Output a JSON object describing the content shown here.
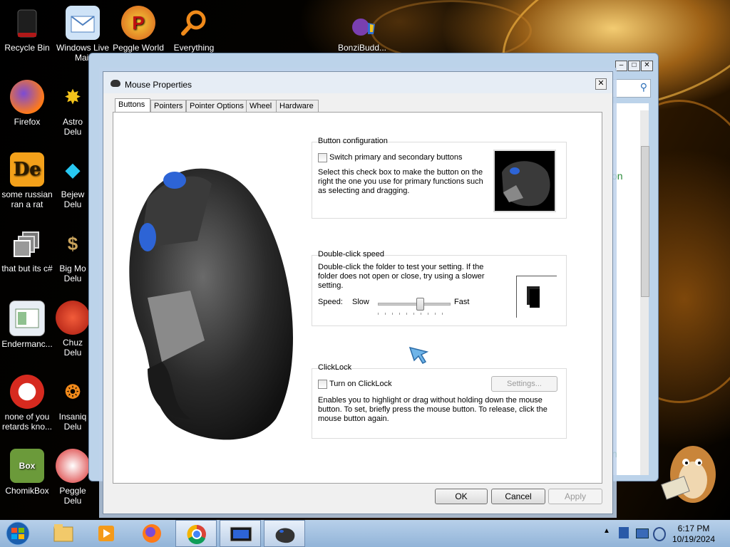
{
  "desktop": {
    "icons": [
      {
        "label": "Recycle Bin"
      },
      {
        "label": "Windows Live Mail"
      },
      {
        "label": "Peggle World"
      },
      {
        "label": "Everything"
      },
      {
        "label": "BonziBudd..."
      },
      {
        "label": "Firefox"
      },
      {
        "label": "Astro Delu"
      },
      {
        "label": "some russian ran a rat"
      },
      {
        "label": "Bejew Delu"
      },
      {
        "label": "that but its c#"
      },
      {
        "label": "Big Mo Delu"
      },
      {
        "label": "Endermanc..."
      },
      {
        "label": "Chuz Delu"
      },
      {
        "label": "none of you retards kno..."
      },
      {
        "label": "Insaniq Delu"
      },
      {
        "label": "ChomikBox"
      },
      {
        "label": "Peggle Delu"
      }
    ]
  },
  "background_window": {
    "partial_text_1": "on",
    "partial_text_2": "n"
  },
  "dialog": {
    "title": "Mouse Properties",
    "close": "✕",
    "tabs": [
      "Buttons",
      "Pointers",
      "Pointer Options",
      "Wheel",
      "Hardware"
    ],
    "active_tab": "Buttons",
    "button_config": {
      "title": "Button configuration",
      "checkbox_label": "Switch primary and secondary buttons",
      "checked": false,
      "description": "Select this check box to make the button on the right the one you use for primary functions such as selecting and dragging."
    },
    "double_click": {
      "title": "Double-click speed",
      "description": "Double-click the folder to test your setting. If the folder does not open or close, try using a slower setting.",
      "speed_label": "Speed:",
      "slow_label": "Slow",
      "fast_label": "Fast",
      "speed_value": 0.58
    },
    "clicklock": {
      "title": "ClickLock",
      "checkbox_label": "Turn on ClickLock",
      "checked": false,
      "settings_button": "Settings...",
      "description": "Enables you to highlight or drag without holding down the mouse button. To set, briefly press the mouse button. To release, click the mouse button again."
    },
    "buttons": {
      "ok": "OK",
      "cancel": "Cancel",
      "apply": "Apply"
    }
  },
  "taskbar": {
    "clock_time": "6:17 PM",
    "clock_date": "10/19/2024"
  },
  "colors": {
    "accent": "#3c7fd4",
    "taskbar": "#a8c4e4"
  }
}
